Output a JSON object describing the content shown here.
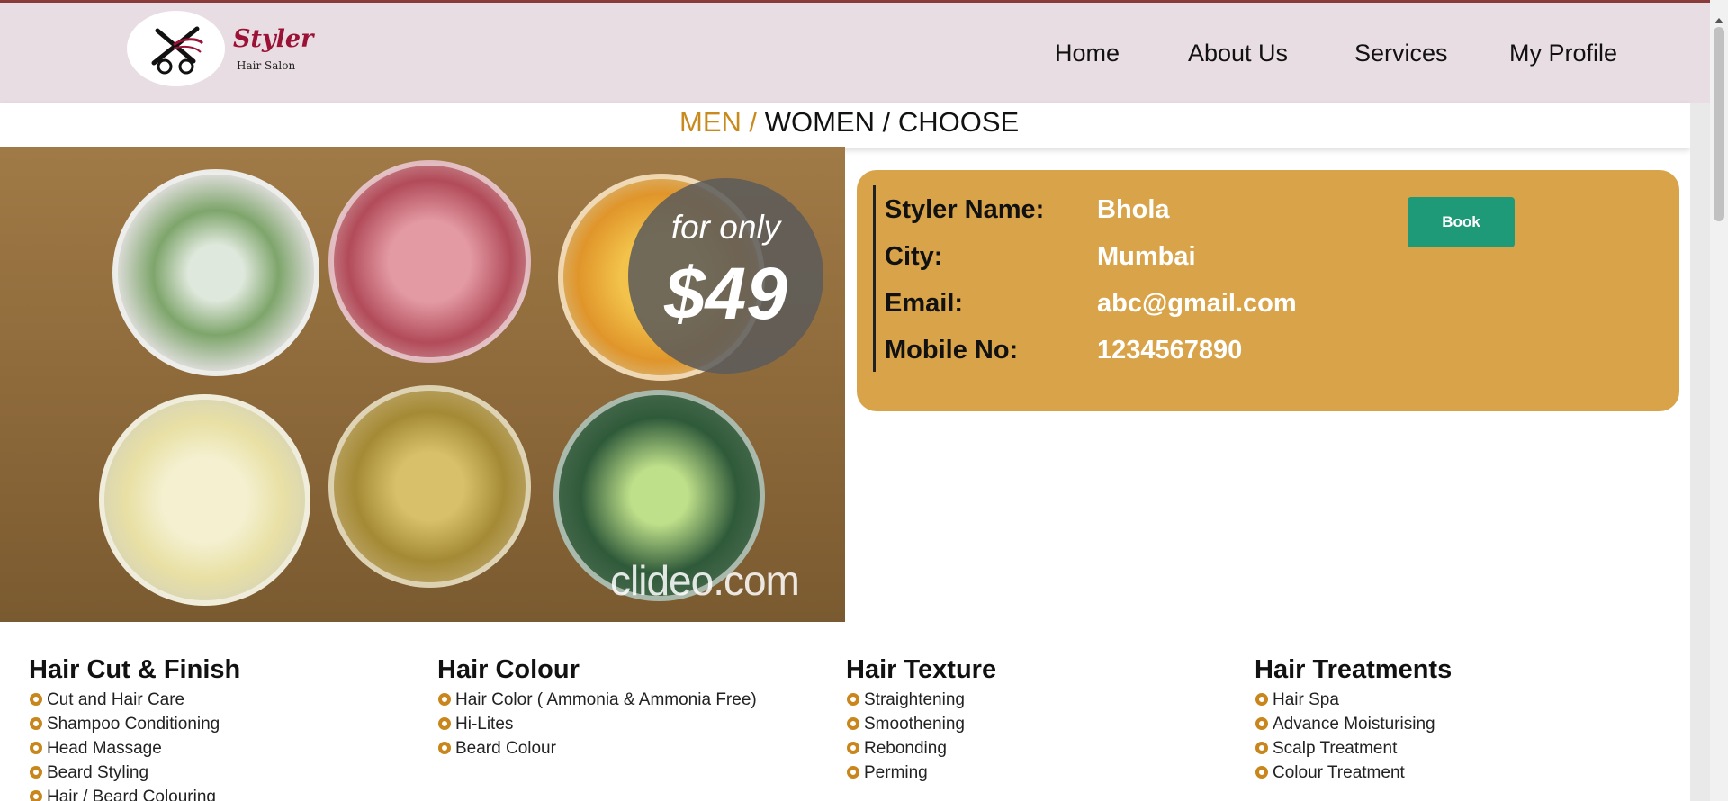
{
  "brand": {
    "name": "Styler",
    "tagline": "Hair Salon",
    "logo_icon": "scissors-icon"
  },
  "nav": {
    "items": [
      {
        "label": "Home"
      },
      {
        "label": "About Us"
      },
      {
        "label": "Services"
      },
      {
        "label": "My Profile"
      }
    ]
  },
  "breadcrumb": {
    "men": "MEN /",
    "rest": " WOMEN / CHOOSE"
  },
  "hero": {
    "badge_small": "for only",
    "badge_big": "$49",
    "watermark": "clideo.com"
  },
  "styler": {
    "name_label": "Styler Name:",
    "name_value": "Bhola",
    "city_label": "City:",
    "city_value": "Mumbai",
    "email_label": "Email:",
    "email_value": "abc@gmail.com",
    "mobile_label": "Mobile No:",
    "mobile_value": "1234567890",
    "book_label": "Book"
  },
  "services": [
    {
      "title": "Hair Cut & Finish",
      "items": [
        "Cut and Hair Care",
        "Shampoo Conditioning",
        "Head Massage",
        "Beard Styling",
        "Hair / Beard Colouring"
      ]
    },
    {
      "title": "Hair Colour",
      "items": [
        "Hair Color ( Ammonia & Ammonia Free)",
        "Hi-Lites",
        "Beard Colour"
      ]
    },
    {
      "title": "Hair Texture",
      "items": [
        "Straightening",
        "Smoothening",
        "Rebonding",
        "Perming"
      ]
    },
    {
      "title": "Hair Treatments",
      "items": [
        "Hair Spa",
        "Advance Moisturising",
        "Scalp Treatment",
        "Colour Treatment"
      ]
    }
  ],
  "colors": {
    "nav_bg": "#e8dde2",
    "brand": "#9b1236",
    "accent": "#c88a1c",
    "card_bg": "#d9a449",
    "book_button": "#1f9a78"
  }
}
